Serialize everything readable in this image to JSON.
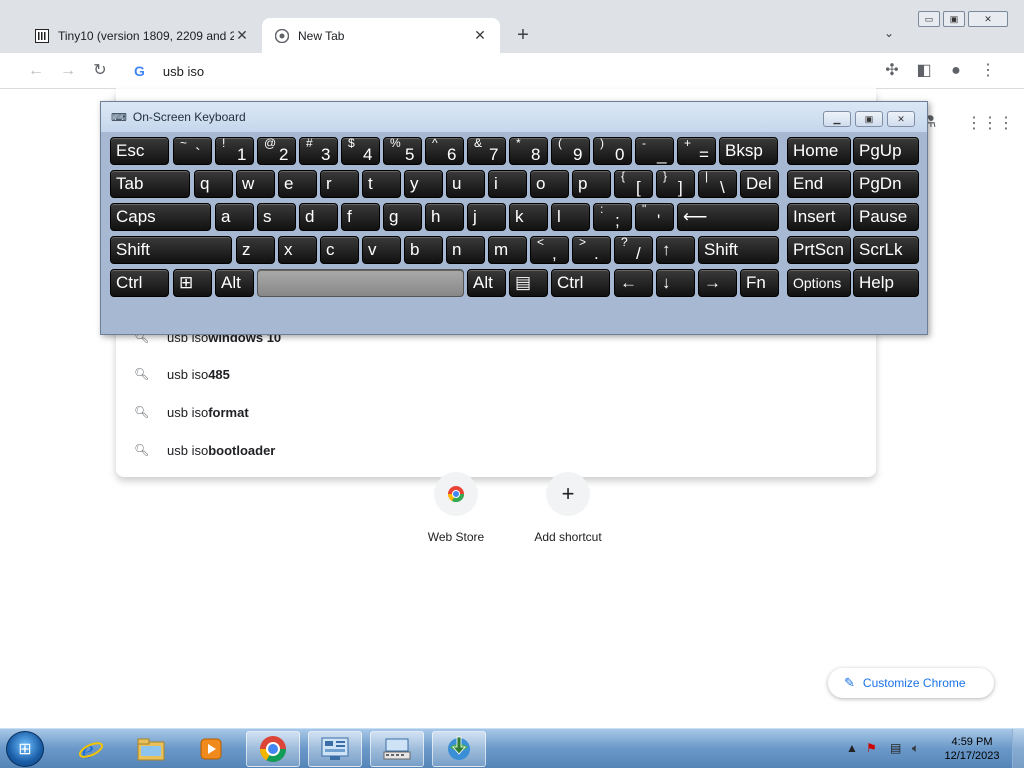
{
  "browser": {
    "tabs": [
      {
        "title": "Tiny10 (version 1809, 2209 and 2",
        "favicon": "archive-icon"
      },
      {
        "title": "New Tab",
        "favicon": "chrome-icon"
      }
    ],
    "window_controls": {
      "minimize": "▭",
      "maximize": "▣",
      "close": "✕"
    },
    "omnibox": {
      "text": "usb iso",
      "engine_glyph": "G"
    },
    "suggestions": [
      {
        "prefix": "usb iso ",
        "bold": "windows 10"
      },
      {
        "prefix": "usb iso ",
        "bold": "485"
      },
      {
        "prefix": "usb iso ",
        "bold": "format"
      },
      {
        "prefix": "usb iso ",
        "bold": "bootloader"
      }
    ],
    "shortcuts": [
      {
        "label": "Web Store"
      },
      {
        "label": "Add shortcut"
      }
    ],
    "customize_label": "Customize Chrome"
  },
  "osk": {
    "title": "On-Screen Keyboard",
    "rows": [
      [
        {
          "t": "Esc"
        },
        {
          "u": "~",
          "l": "`"
        },
        {
          "u": "!",
          "l": "1"
        },
        {
          "u": "@",
          "l": "2"
        },
        {
          "u": "#",
          "l": "3"
        },
        {
          "u": "$",
          "l": "4"
        },
        {
          "u": "%",
          "l": "5"
        },
        {
          "u": "^",
          "l": "6"
        },
        {
          "u": "&",
          "l": "7"
        },
        {
          "u": "*",
          "l": "8"
        },
        {
          "u": "(",
          "l": "9"
        },
        {
          "u": ")",
          "l": "0"
        },
        {
          "u": "-",
          "l": "_"
        },
        {
          "u": "+",
          "l": "="
        },
        {
          "t": "Bksp"
        },
        {
          "t": "Home"
        },
        {
          "t": "PgUp"
        }
      ],
      [
        {
          "t": "Tab"
        },
        {
          "t": "q"
        },
        {
          "t": "w"
        },
        {
          "t": "e"
        },
        {
          "t": "r"
        },
        {
          "t": "t"
        },
        {
          "t": "y"
        },
        {
          "t": "u"
        },
        {
          "t": "i"
        },
        {
          "t": "o"
        },
        {
          "t": "p"
        },
        {
          "u": "{",
          "l": "["
        },
        {
          "u": "}",
          "l": "]"
        },
        {
          "u": "|",
          "l": "\\"
        },
        {
          "t": "Del"
        },
        {
          "t": "End"
        },
        {
          "t": "PgDn"
        }
      ],
      [
        {
          "t": "Caps"
        },
        {
          "t": "a"
        },
        {
          "t": "s"
        },
        {
          "t": "d"
        },
        {
          "t": "f"
        },
        {
          "t": "g"
        },
        {
          "t": "h"
        },
        {
          "t": "j"
        },
        {
          "t": "k"
        },
        {
          "t": "l"
        },
        {
          "u": ":",
          "l": ";"
        },
        {
          "u": "\"",
          "l": "'"
        },
        {
          "t": "⟵"
        },
        {
          "t": "Insert"
        },
        {
          "t": "Pause"
        }
      ],
      [
        {
          "t": "Shift"
        },
        {
          "t": "z"
        },
        {
          "t": "x"
        },
        {
          "t": "c"
        },
        {
          "t": "v"
        },
        {
          "t": "b"
        },
        {
          "t": "n"
        },
        {
          "t": "m"
        },
        {
          "u": "<",
          "l": ","
        },
        {
          "u": ">",
          "l": "."
        },
        {
          "u": "?",
          "l": "/"
        },
        {
          "t": "↑"
        },
        {
          "t": "Shift"
        },
        {
          "t": "PrtScn"
        },
        {
          "t": "ScrLk"
        }
      ],
      [
        {
          "t": "Ctrl"
        },
        {
          "t": "⊞"
        },
        {
          "t": "Alt"
        },
        {
          "t": ""
        },
        {
          "t": "Alt"
        },
        {
          "t": "▤"
        },
        {
          "t": "Ctrl"
        },
        {
          "t": "←"
        },
        {
          "t": "↓"
        },
        {
          "t": "→"
        },
        {
          "t": "Fn"
        },
        {
          "t": "Options"
        },
        {
          "t": "Help"
        }
      ]
    ]
  },
  "taskbar": {
    "apps": [
      "ie-icon",
      "explorer-icon",
      "media-player-icon",
      "chrome-icon",
      "control-panel-icon",
      "osk-icon",
      "idm-icon"
    ],
    "time": "4:59 PM",
    "date": "12/17/2023"
  }
}
